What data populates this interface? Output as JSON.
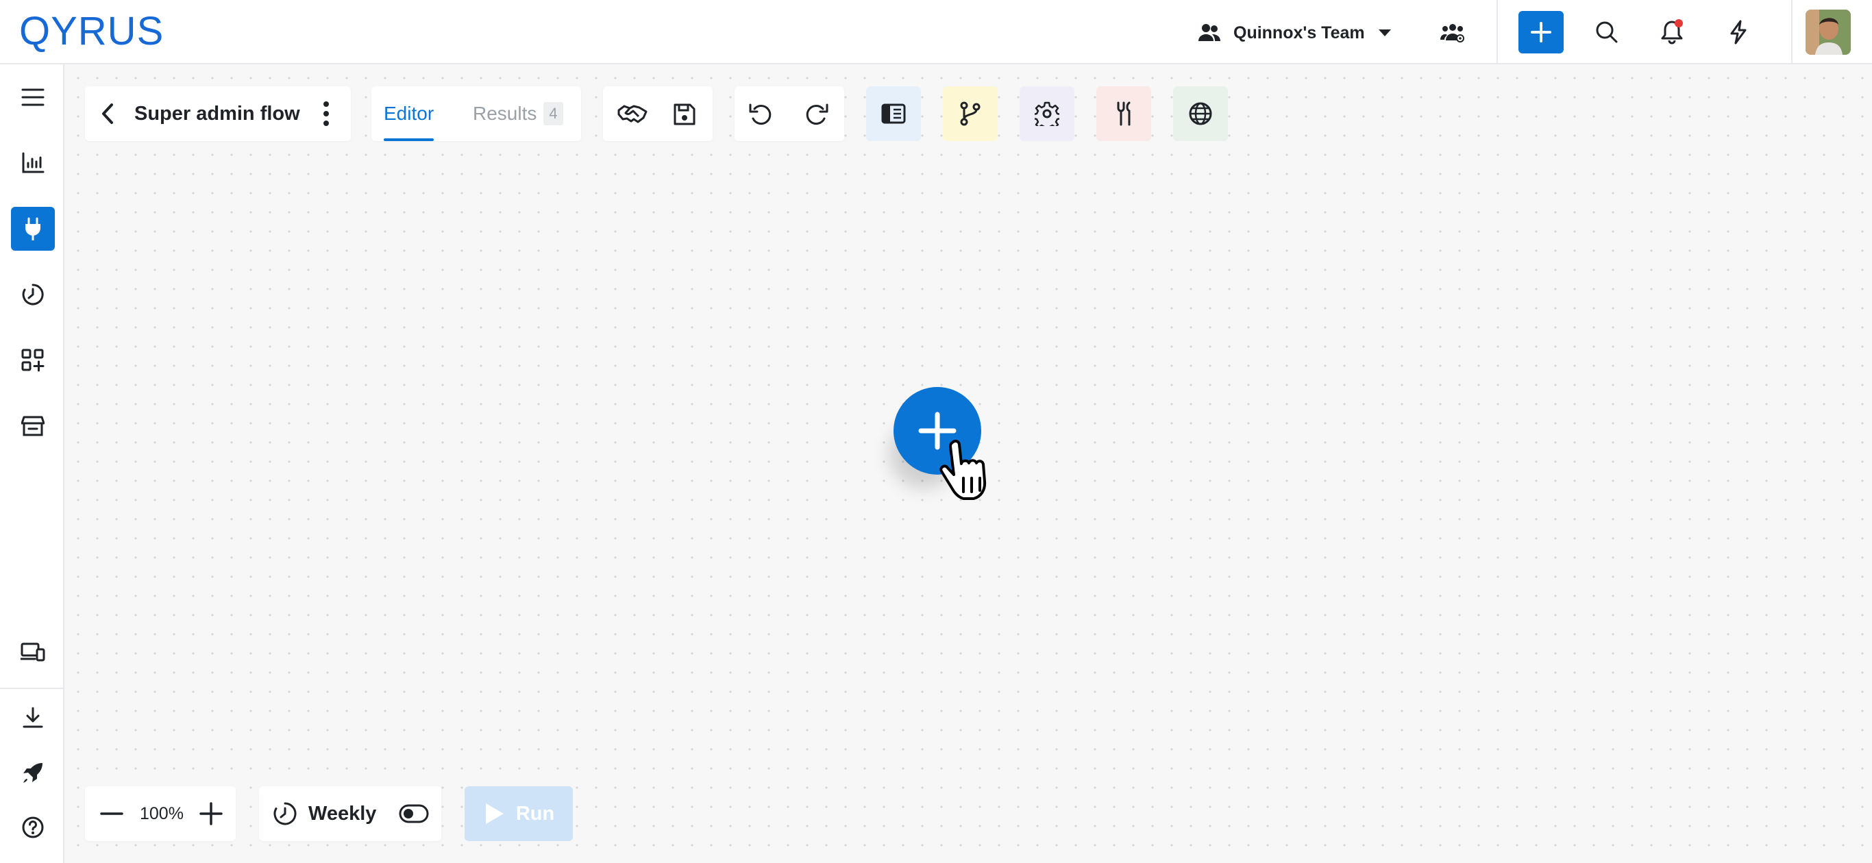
{
  "app": {
    "logo_text": "QYRUS",
    "brand_color": "#0b75d6"
  },
  "header": {
    "team_name": "Quinnox's Team",
    "notification_dot_color": "#e53935"
  },
  "sidebar": {
    "items": [
      {
        "name": "menu",
        "icon": "hamburger-icon"
      },
      {
        "name": "dashboard",
        "icon": "bar-chart-icon"
      },
      {
        "name": "integrations",
        "icon": "plug-icon",
        "active": true
      },
      {
        "name": "history",
        "icon": "history-icon"
      },
      {
        "name": "add-apps",
        "icon": "apps-plus-icon"
      },
      {
        "name": "store",
        "icon": "store-icon"
      },
      {
        "name": "devices",
        "icon": "devices-icon"
      },
      {
        "name": "download",
        "icon": "download-icon"
      },
      {
        "name": "launch",
        "icon": "rocket-icon"
      },
      {
        "name": "help",
        "icon": "help-icon"
      }
    ]
  },
  "flow": {
    "title": "Super admin flow",
    "tabs": [
      {
        "label": "Editor",
        "active": true
      },
      {
        "label": "Results",
        "count": "4"
      }
    ]
  },
  "toolbar": {
    "tools": [
      "handshake-icon",
      "save-icon",
      "undo-icon",
      "redo-icon",
      "sidebar-panel-icon",
      "branch-icon",
      "settings-icon",
      "tools-icon",
      "globe-icon"
    ]
  },
  "zoom": {
    "value": "100%"
  },
  "schedule": {
    "label": "Weekly",
    "enabled": false
  },
  "run": {
    "label": "Run",
    "disabled": true
  }
}
